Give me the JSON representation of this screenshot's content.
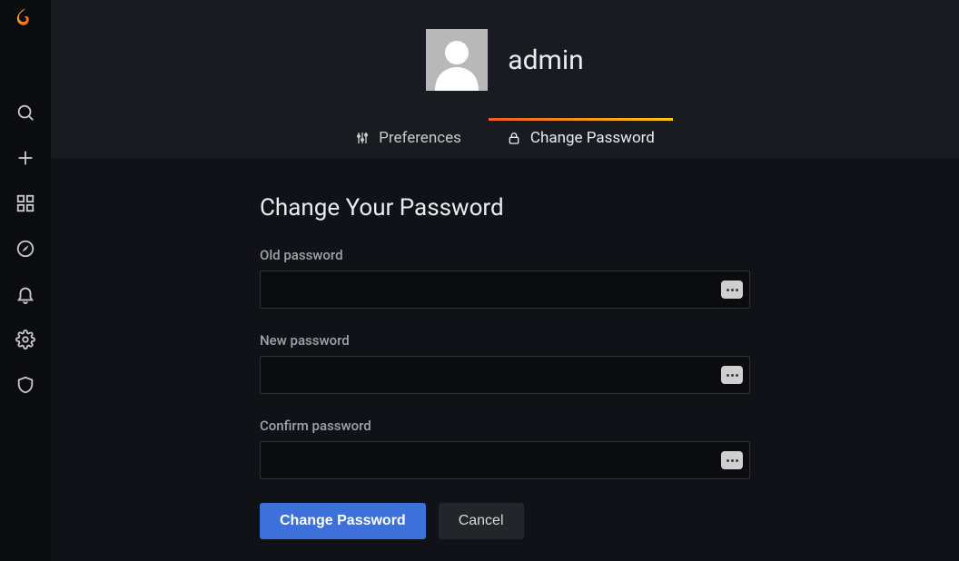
{
  "sidebar": {
    "icons": [
      "search",
      "plus",
      "dashboards",
      "compass",
      "bell",
      "gear",
      "shield"
    ]
  },
  "header": {
    "username": "admin"
  },
  "tabs": [
    {
      "label": "Preferences",
      "icon": "sliders",
      "active": false
    },
    {
      "label": "Change Password",
      "icon": "lock",
      "active": true
    }
  ],
  "form": {
    "title": "Change Your Password",
    "fields": [
      {
        "label": "Old password",
        "value": ""
      },
      {
        "label": "New password",
        "value": ""
      },
      {
        "label": "Confirm password",
        "value": ""
      }
    ],
    "submit_label": "Change Password",
    "cancel_label": "Cancel"
  }
}
